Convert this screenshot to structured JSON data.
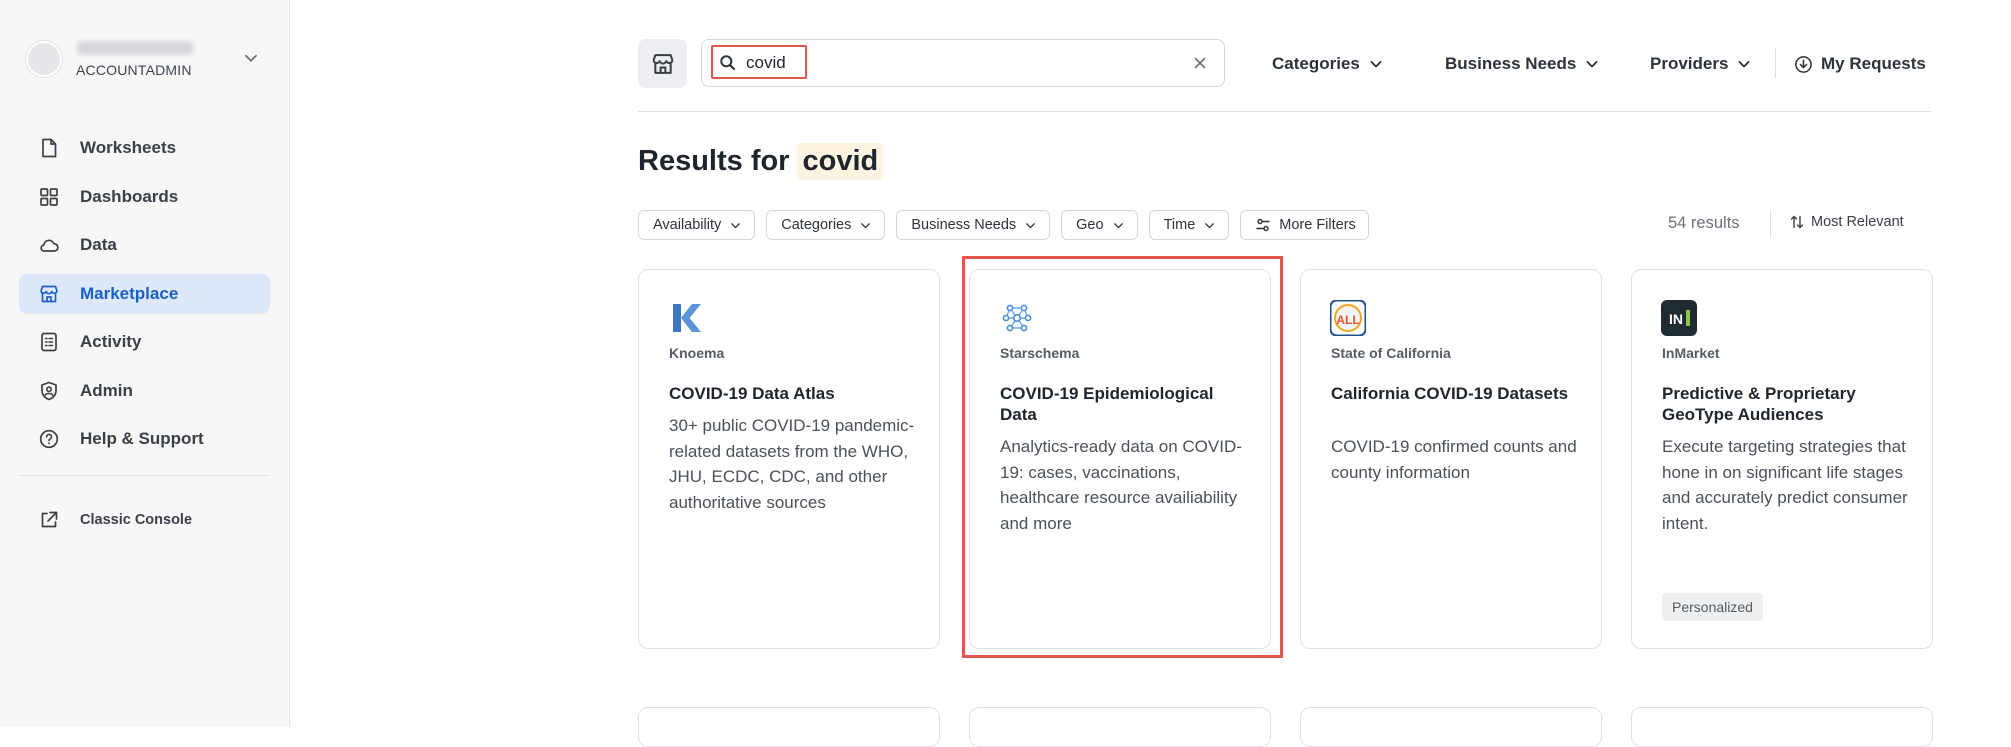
{
  "sidebar": {
    "account": {
      "role": "ACCOUNTADMIN"
    },
    "items": [
      {
        "label": "Worksheets",
        "icon": "worksheet-icon"
      },
      {
        "label": "Dashboards",
        "icon": "dashboard-grid-icon"
      },
      {
        "label": "Data",
        "icon": "cloud-icon"
      },
      {
        "label": "Marketplace",
        "icon": "storefront-icon",
        "active": true
      },
      {
        "label": "Activity",
        "icon": "activity-list-icon"
      },
      {
        "label": "Admin",
        "icon": "shield-user-icon"
      },
      {
        "label": "Help & Support",
        "icon": "help-circle-icon"
      }
    ],
    "classic_console": "Classic Console"
  },
  "topbar": {
    "search_value": "covid",
    "nav": [
      "Categories",
      "Business Needs",
      "Providers"
    ],
    "my_requests": "My Requests"
  },
  "results": {
    "prefix": "Results for",
    "term": "covid",
    "count": "54 results",
    "sort": "Most Relevant"
  },
  "filters": [
    "Availability",
    "Categories",
    "Business Needs",
    "Geo",
    "Time"
  ],
  "more_filters": "More Filters",
  "cards": [
    {
      "provider": "Knoema",
      "title": "COVID-19 Data Atlas",
      "description": "30+ public COVID-19 pandemic-related datasets from the WHO, JHU, ECDC, CDC, and other authoritative sources",
      "logo": "knoema-logo"
    },
    {
      "provider": "Starschema",
      "title": "COVID-19 Epidemiological Data",
      "description": "Analytics-ready data on COVID-19: cases, vaccinations, healthcare resource availiability and more",
      "logo": "starschema-logo"
    },
    {
      "provider": "State of California",
      "title": "California COVID-19 Datasets",
      "description": "COVID-19 confirmed counts and county information",
      "logo": "state-of-california-logo",
      "logo_text": "ALL"
    },
    {
      "provider": "InMarket",
      "title": "Predictive & Proprietary GeoType Audiences",
      "description": "Execute targeting strategies that hone in on significant life stages and accurately predict consumer intent.",
      "badge": "Personalized",
      "logo": "inmarket-logo",
      "logo_text": "IN"
    }
  ],
  "colors": {
    "accent": "#1a5fc8",
    "active_bg": "#dde9fb",
    "highlight": "#e2574c",
    "term_bg": "#fdf3e1"
  }
}
